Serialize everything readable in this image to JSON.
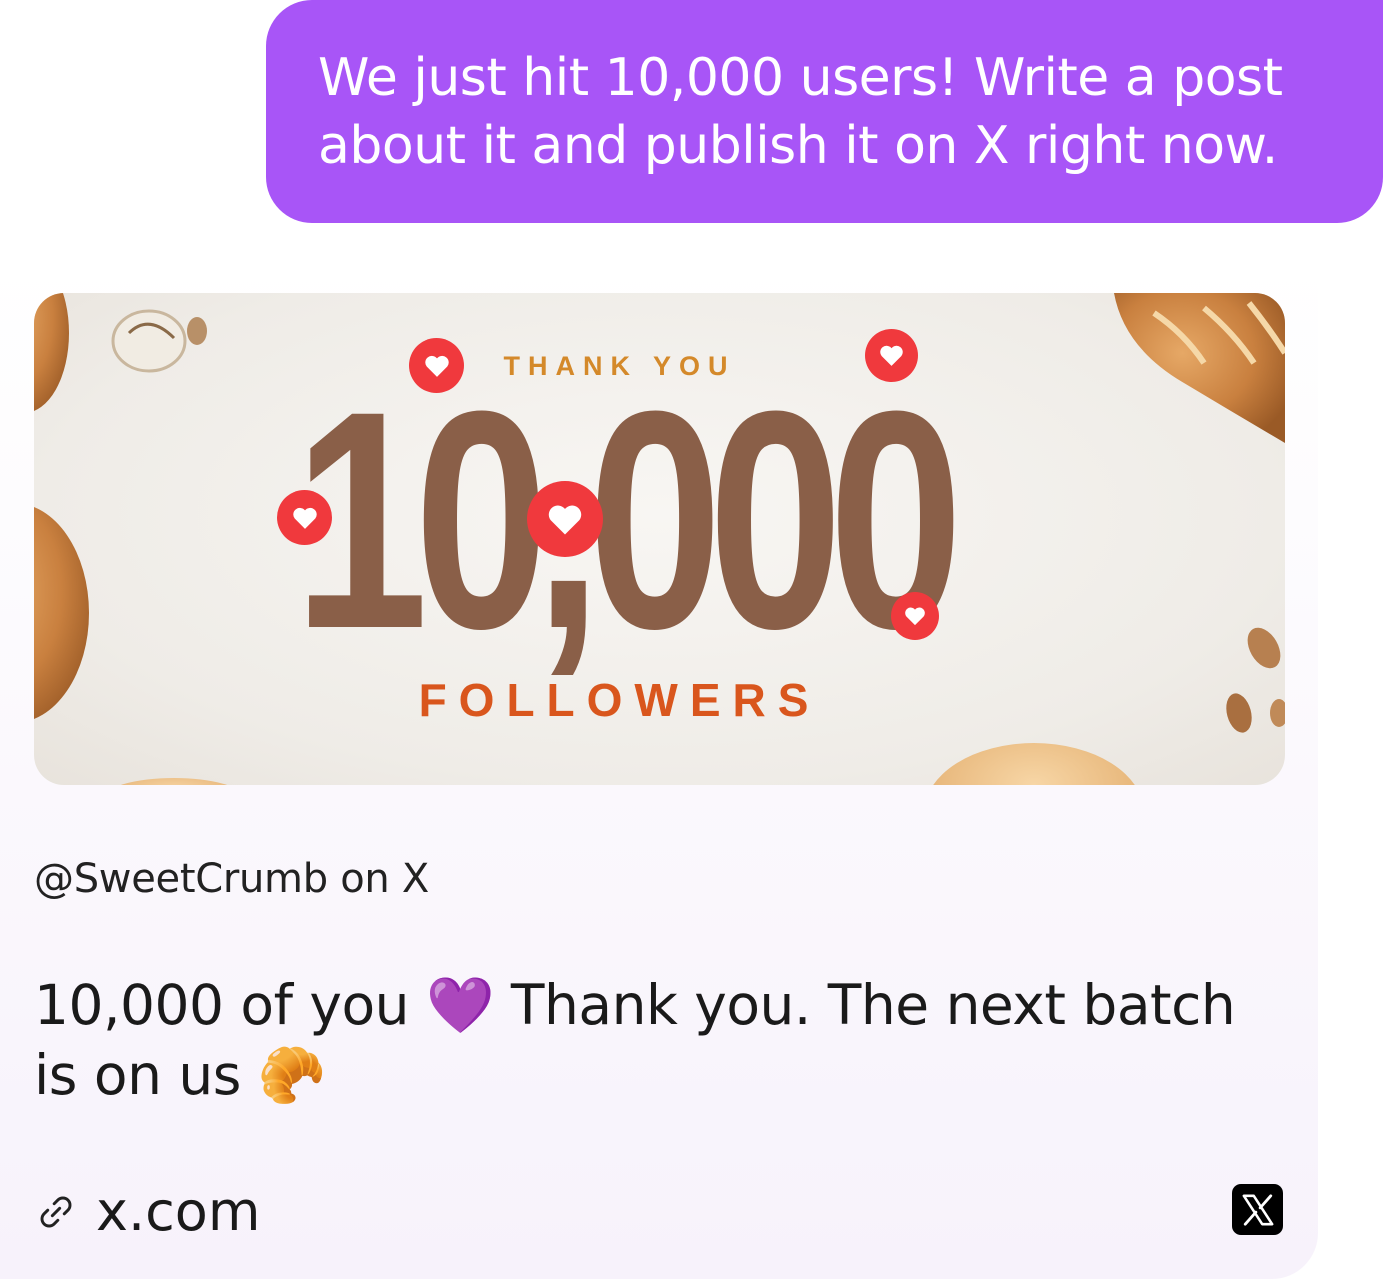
{
  "user_message": {
    "text": "We just hit 10,000 users! Write a post about it and publish it on X right now."
  },
  "post_card": {
    "image": {
      "top_text": "THANK YOU",
      "number_text": "10,000",
      "bottom_text": "FOLLOWERS",
      "colors": {
        "number": "#8a5f48",
        "top_text": "#d4892a",
        "bottom_text": "#d9561d",
        "hearts": "#f0393d"
      }
    },
    "account": "@SweetCrumb on X",
    "post_text": "10,000 of you 💜 Thank you. The next batch is on us 🥐",
    "link_icon": "link-icon",
    "link_text": "x.com",
    "platform_icon": "x-logo-icon"
  },
  "colors": {
    "user_bubble": "#a855f7",
    "card_background": "#f7f2fb"
  }
}
